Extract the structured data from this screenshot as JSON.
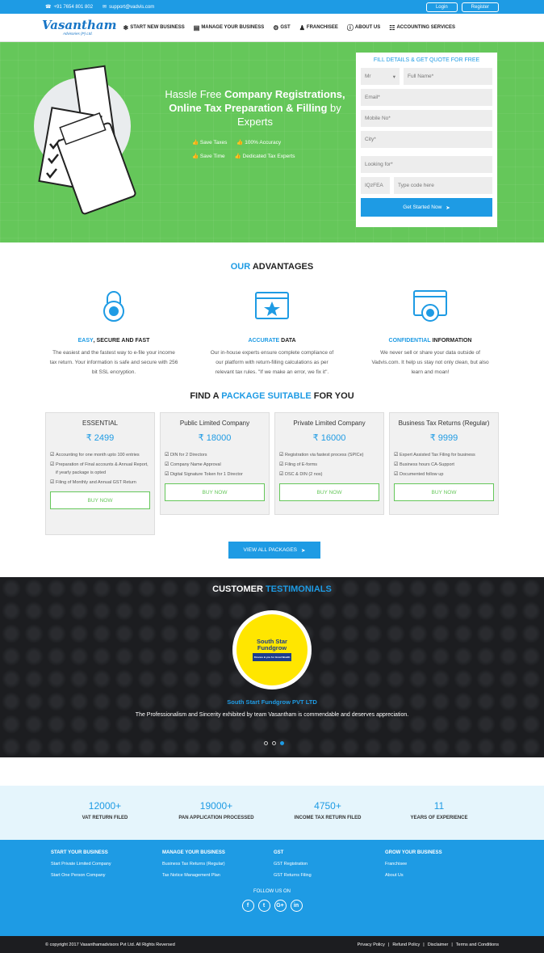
{
  "topbar": {
    "phone": "+91 7654 801 802",
    "email": "support@vadvis.com",
    "login": "Login",
    "register": "Register"
  },
  "logo": {
    "name": "Vasantham",
    "tagline": "Advisories (P) Ltd."
  },
  "menu": [
    "START NEW BUSINESS",
    "MANAGE YOUR BUSINESS",
    "GST",
    "FRANCHISEE",
    "ABOUT US",
    "ACCOUNTING SERVICES"
  ],
  "hero": {
    "h1_pre": "Hassle Free ",
    "h1_bold": "Company Registrations, Online Tax Preparation & Filling",
    " h1_post": " by Experts",
    "checks": [
      "Save Taxes",
      "100% Accuracy",
      "Save Time",
      "Dedicated Tax Experts"
    ]
  },
  "form": {
    "title": "FILL DETAILS & GET QUOTE FOR FREE",
    "salutation": "Mr",
    "name": "Full Name*",
    "email": "Email*",
    "mobile": "Mobile No*",
    "city": "City*",
    "looking": "Looking for*",
    "captcha": "IQzFEA",
    "code": "Type code here",
    "submit": "Get Started Now"
  },
  "advantages": {
    "title_a": "OUR",
    "title_b": " ADVANTAGES",
    "items": [
      {
        "h_a": "EASY",
        "h_b": ", SECURE AND FAST",
        "text": "The easiest and the fastest way to e-file your income tax return. Your information is safe and secure with 256 bit SSL encryption."
      },
      {
        "h_a": "ACCURATE",
        "h_b": " DATA",
        "text": "Our in-house experts ensure complete compliance of our platform with return-filling calculations as per relevant tax rules. \"If we make an error, we fix it\"."
      },
      {
        "h_a": "CONFIDENTIAL",
        "h_b": " INFORMATION",
        "text": "We never sell or share your data outside of Vadvis.com. It help us stay not only clean, but also learn and moan!"
      }
    ]
  },
  "packages": {
    "t1": "FIND A ",
    "t2": "PACKAGE SUITABLE",
    "t3": " FOR YOU",
    "cards": [
      {
        "name": "ESSENTIAL",
        "price": "₹ 2499",
        "items": [
          "Accounting for one month upto 100 entries",
          "Preparation of Final accounts & Annual Report, if yearly package is opted",
          "Filing of Monthly and Annual GST Return"
        ],
        "buy": "BUY NOW"
      },
      {
        "name": "Public Limited Company",
        "price": "₹ 18000",
        "items": [
          "DIN for 2 Directors",
          "Company Name Approval",
          "Digital Signature Token for 1 Director"
        ],
        "buy": "BUY NOW"
      },
      {
        "name": "Private Limited Company",
        "price": "₹ 16000",
        "items": [
          "Registration via fastest process (SPICe)",
          "Filing of E-forms",
          "DSC & DIN (2 nos)"
        ],
        "buy": "BUY NOW"
      },
      {
        "name": "Business Tax Returns (Regular)",
        "price": "₹ 9999",
        "items": [
          "Expert Assisted Tax Filing for business",
          "Business hours CA-Support",
          "Documented follow up"
        ],
        "buy": "BUY NOW"
      }
    ],
    "view_all": "VIEW ALL PACKAGES"
  },
  "testimonials": {
    "t1": "CUSTOMER ",
    "t2": "TESTIMONIALS",
    "logo1": "South Star",
    "logo2": "Fundgrow",
    "logo_tag": "Finance & you for Great Wealth",
    "name": "South Start Fundgrow PVT LTD",
    "quote": "The Professionalism and Sincerity exhibited by team Vasantham is commendable and deserves appreciation."
  },
  "stats": [
    {
      "n": "12000+",
      "l": "VAT RETURN FILED"
    },
    {
      "n": "19000+",
      "l": "PAN APPLICATION PROCESSED"
    },
    {
      "n": "4750+",
      "l": "INCOME TAX RETURN FILED"
    },
    {
      "n": "11",
      "l": "YEARS OF EXPERIENCE"
    }
  ],
  "footer": {
    "cols": [
      {
        "h": "START YOUR BUSINESS",
        "links": [
          "Start Private Limited Company",
          "Start One Person Company"
        ]
      },
      {
        "h": "MANAGE YOUR BUSINESS",
        "links": [
          "Business Tax Returns (Regular)",
          "Tax Notice Management Plan"
        ]
      },
      {
        "h": "GST",
        "links": [
          "GST Registration",
          "GST Returns Filing"
        ]
      },
      {
        "h": "GROW YOUR BUSINESS",
        "links": [
          "Franchisee",
          "About Us"
        ]
      }
    ],
    "follow": "FOLLOW US ON",
    "social": [
      "f",
      "t",
      "G+",
      "in"
    ]
  },
  "copy": {
    "text": "© copyright 2017 Vasanthamadvisors Pvt Ltd. All Rights Reversed",
    "links": [
      "Privacy Policy",
      "Refund Policy",
      "Disclaimer",
      "Terms and Conditions"
    ]
  }
}
